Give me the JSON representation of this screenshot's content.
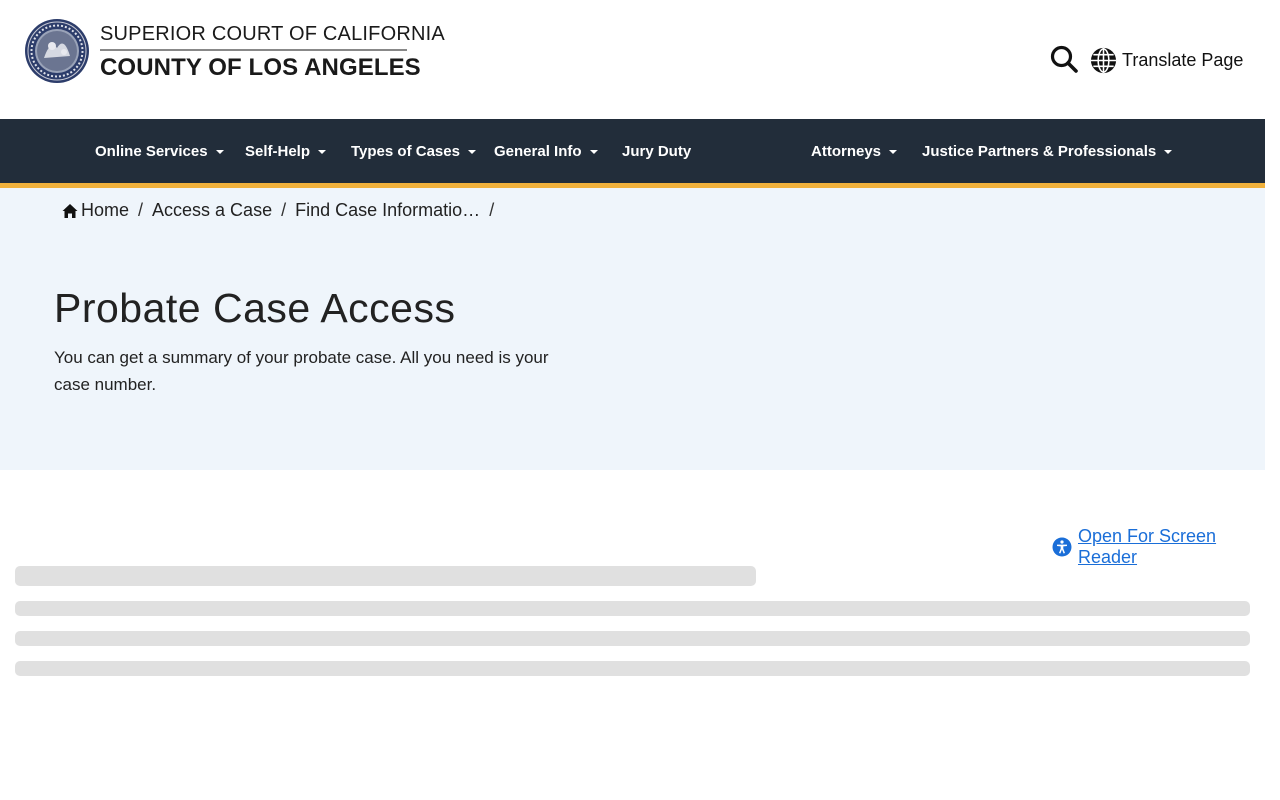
{
  "header": {
    "brand_line1": "SUPERIOR COURT OF CALIFORNIA",
    "brand_line2": "COUNTY OF LOS ANGELES",
    "seal_icon": "court-seal-icon",
    "search_icon": "search-icon",
    "translate_label": "Translate Page",
    "translate_icon": "globe-icon"
  },
  "nav": {
    "items": [
      {
        "label": "Online Services",
        "dropdown": true
      },
      {
        "label": "Self-Help",
        "dropdown": true
      },
      {
        "label": "Types of Cases",
        "dropdown": true
      },
      {
        "label": "General Info",
        "dropdown": true
      },
      {
        "label": "Jury Duty",
        "dropdown": false
      },
      {
        "label": "Attorneys",
        "dropdown": true
      },
      {
        "label": "Justice Partners & Professionals",
        "dropdown": true
      }
    ]
  },
  "breadcrumb": {
    "items": [
      "Home",
      "Access a Case",
      "Find Case Informatio…"
    ],
    "separator": "/"
  },
  "hero": {
    "title": "Probate Case Access",
    "subtitle": "You can get a summary of your probate case. All you need is your case number."
  },
  "screen_reader": {
    "label": "Open For Screen Reader",
    "icon": "accessibility-icon"
  },
  "colors": {
    "nav_bg": "#222d3a",
    "nav_accent": "#f0b13c",
    "hero_bg": "#eff5fb",
    "link": "#1a6ed8",
    "skeleton": "#e0e0e0"
  }
}
